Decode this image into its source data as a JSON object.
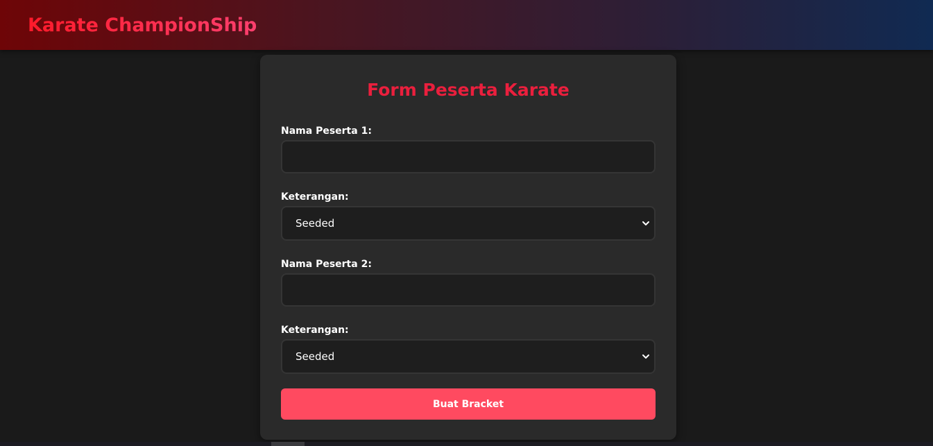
{
  "header": {
    "brand": "Karate ChampionShip"
  },
  "form": {
    "title": "Form Peserta Karate",
    "participant1": {
      "label": "Nama Peserta 1:",
      "value": "",
      "placeholder": ""
    },
    "note1": {
      "label": "Keterangan:",
      "selected": "Seeded"
    },
    "participant2": {
      "label": "Nama Peserta 2:",
      "value": "",
      "placeholder": ""
    },
    "note2": {
      "label": "Keterangan:",
      "selected": "Seeded"
    },
    "submit_label": "Buat Bracket"
  },
  "icons": {
    "dropdown": "chevron-down-icon"
  },
  "colors": {
    "accent": "#ea1f3d",
    "button": "#ff4a60",
    "background": "#1a1a1a",
    "card": "#2a2a2a"
  }
}
